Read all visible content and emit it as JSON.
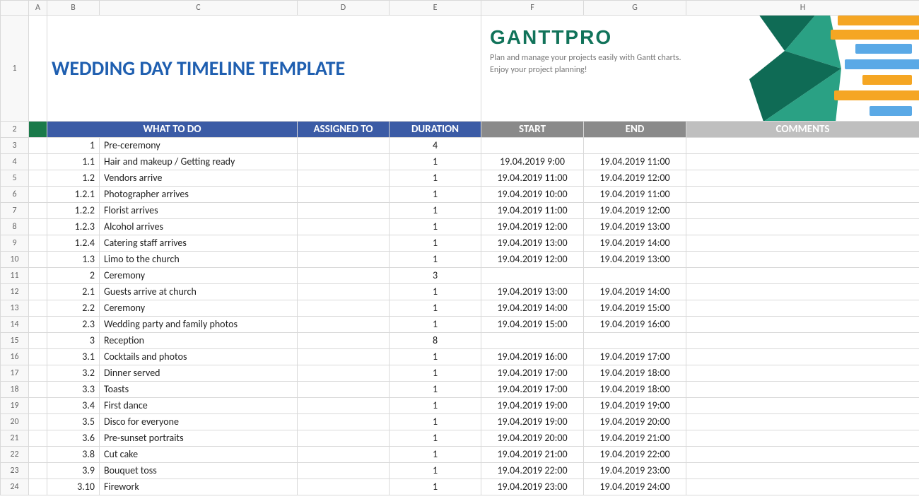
{
  "columns": [
    "A",
    "B",
    "C",
    "D",
    "E",
    "F",
    "G",
    "H"
  ],
  "title": "WEDDING DAY TIMELINE TEMPLATE",
  "brand": {
    "logo": "GANTTPRO",
    "tagline1": "Plan and manage your projects easily with Gantt charts.",
    "tagline2": "Enjoy your project planning!"
  },
  "headers": {
    "what": "WHAT TO DO",
    "assigned": "ASSIGNED TO",
    "duration": "DURATION",
    "start": "START",
    "end": "END",
    "comments": "COMMENTS"
  },
  "rows": [
    {
      "n": "3",
      "idx": "1",
      "task": "Pre-ceremony",
      "dur": "4",
      "start": "",
      "end": ""
    },
    {
      "n": "4",
      "idx": "1.1",
      "task": "Hair and makeup / Getting ready",
      "dur": "1",
      "start": "19.04.2019 9:00",
      "end": "19.04.2019 11:00"
    },
    {
      "n": "5",
      "idx": "1.2",
      "task": "Vendors arrive",
      "dur": "1",
      "start": "19.04.2019 11:00",
      "end": "19.04.2019 12:00"
    },
    {
      "n": "6",
      "idx": "1.2.1",
      "task": "Photographer arrives",
      "dur": "1",
      "start": "19.04.2019 10:00",
      "end": "19.04.2019 11:00"
    },
    {
      "n": "7",
      "idx": "1.2.2",
      "task": "Florist arrives",
      "dur": "1",
      "start": "19.04.2019 11:00",
      "end": "19.04.2019 12:00"
    },
    {
      "n": "8",
      "idx": "1.2.3",
      "task": "Alcohol arrives",
      "dur": "1",
      "start": "19.04.2019 12:00",
      "end": "19.04.2019 13:00"
    },
    {
      "n": "9",
      "idx": "1.2.4",
      "task": "Catering staff arrives",
      "dur": "1",
      "start": "19.04.2019 13:00",
      "end": "19.04.2019 14:00"
    },
    {
      "n": "10",
      "idx": "1.3",
      "task": "Limo to the church",
      "dur": "1",
      "start": "19.04.2019 12:00",
      "end": "19.04.2019 13:00"
    },
    {
      "n": "11",
      "idx": "2",
      "task": "Ceremony",
      "dur": "3",
      "start": "",
      "end": ""
    },
    {
      "n": "12",
      "idx": "2.1",
      "task": "Guests arrive at church",
      "dur": "1",
      "start": "19.04.2019 13:00",
      "end": "19.04.2019 14:00"
    },
    {
      "n": "13",
      "idx": "2.2",
      "task": "Ceremony",
      "dur": "1",
      "start": "19.04.2019 14:00",
      "end": "19.04.2019 15:00"
    },
    {
      "n": "14",
      "idx": "2.3",
      "task": "Wedding party and family photos",
      "dur": "1",
      "start": "19.04.2019 15:00",
      "end": "19.04.2019 16:00"
    },
    {
      "n": "15",
      "idx": "3",
      "task": "Reception",
      "dur": "8",
      "start": "",
      "end": ""
    },
    {
      "n": "16",
      "idx": "3.1",
      "task": "Cocktails and photos",
      "dur": "1",
      "start": "19.04.2019 16:00",
      "end": "19.04.2019 17:00"
    },
    {
      "n": "17",
      "idx": "3.2",
      "task": "Dinner served",
      "dur": "1",
      "start": "19.04.2019 17:00",
      "end": "19.04.2019 18:00"
    },
    {
      "n": "18",
      "idx": "3.3",
      "task": "Toasts",
      "dur": "1",
      "start": "19.04.2019 17:00",
      "end": "19.04.2019 18:00"
    },
    {
      "n": "19",
      "idx": "3.4",
      "task": "First dance",
      "dur": "1",
      "start": "19.04.2019 19:00",
      "end": "19.04.2019 19:00"
    },
    {
      "n": "20",
      "idx": "3.5",
      "task": "Disco for everyone",
      "dur": "1",
      "start": "19.04.2019 19:00",
      "end": "19.04.2019 20:00"
    },
    {
      "n": "21",
      "idx": "3.6",
      "task": "Pre-sunset portraits",
      "dur": "1",
      "start": "19.04.2019 20:00",
      "end": "19.04.2019 21:00"
    },
    {
      "n": "22",
      "idx": "3.8",
      "task": "Cut cake",
      "dur": "1",
      "start": "19.04.2019 21:00",
      "end": "19.04.2019 22:00"
    },
    {
      "n": "23",
      "idx": "3.9",
      "task": "Bouquet toss",
      "dur": "1",
      "start": "19.04.2019 22:00",
      "end": "19.04.2019 23:00"
    },
    {
      "n": "24",
      "idx": "3.10",
      "task": "Firework",
      "dur": "1",
      "start": "19.04.2019 23:00",
      "end": "19.04.2019 24:00"
    }
  ]
}
